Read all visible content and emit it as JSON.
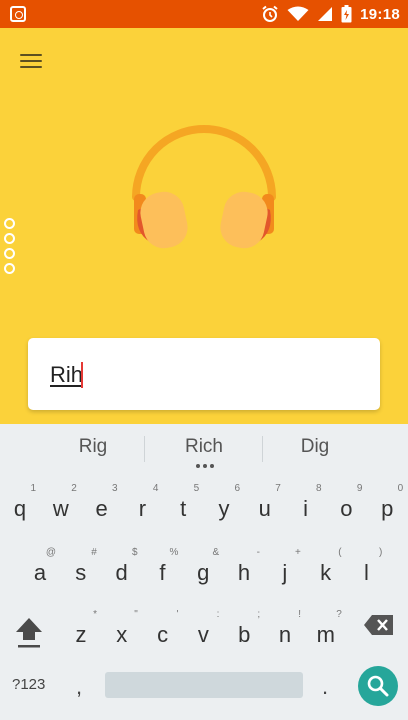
{
  "status_bar": {
    "time": "19:18",
    "icons": [
      "screenshot-icon",
      "alarm-icon",
      "wifi-icon",
      "signal-icon",
      "battery-icon"
    ],
    "color": "#E65100"
  },
  "app": {
    "background": "#FBD23A",
    "menu_icon": "menu-icon",
    "illustration": "headphones-icon",
    "search": {
      "value": "Rih"
    }
  },
  "keyboard": {
    "suggestions": [
      "Rig",
      "Rich",
      "Dig"
    ],
    "row1": [
      {
        "key": "q",
        "hint": "1"
      },
      {
        "key": "w",
        "hint": "2"
      },
      {
        "key": "e",
        "hint": "3"
      },
      {
        "key": "r",
        "hint": "4"
      },
      {
        "key": "t",
        "hint": "5"
      },
      {
        "key": "y",
        "hint": "6"
      },
      {
        "key": "u",
        "hint": "7"
      },
      {
        "key": "i",
        "hint": "8"
      },
      {
        "key": "o",
        "hint": "9"
      },
      {
        "key": "p",
        "hint": "0"
      }
    ],
    "row2": [
      {
        "key": "a",
        "hint": "@"
      },
      {
        "key": "s",
        "hint": "#"
      },
      {
        "key": "d",
        "hint": "$"
      },
      {
        "key": "f",
        "hint": "%"
      },
      {
        "key": "g",
        "hint": "&"
      },
      {
        "key": "h",
        "hint": "-"
      },
      {
        "key": "j",
        "hint": "+"
      },
      {
        "key": "k",
        "hint": "("
      },
      {
        "key": "l",
        "hint": ")"
      }
    ],
    "row3": [
      {
        "key": "z",
        "hint": "*"
      },
      {
        "key": "x",
        "hint": "\""
      },
      {
        "key": "c",
        "hint": "'"
      },
      {
        "key": "v",
        "hint": ":"
      },
      {
        "key": "b",
        "hint": ";"
      },
      {
        "key": "n",
        "hint": "!"
      },
      {
        "key": "m",
        "hint": "?"
      }
    ],
    "symbols_label": "?123",
    "comma": ",",
    "period": ".",
    "action_color": "#26A69A"
  }
}
